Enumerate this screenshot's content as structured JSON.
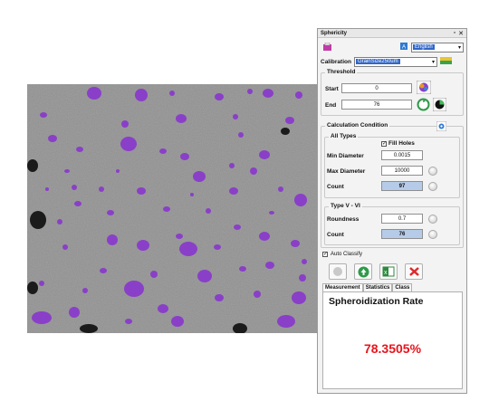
{
  "panel": {
    "title": "Sphericity",
    "language": "English",
    "calibration_label": "Calibration",
    "calibration_value": "GrainSize250um",
    "threshold": {
      "title": "Threshold",
      "start_label": "Start",
      "start_value": "0",
      "end_label": "End",
      "end_value": "76"
    },
    "calc": {
      "title": "Calculation Condition",
      "all_types": {
        "title": "All Types",
        "fill_holes": "Fill Holes",
        "min_diameter_label": "Min Diameter",
        "min_diameter_value": "0.0015",
        "max_diameter_label": "Max Diameter",
        "max_diameter_value": "10000",
        "count_label": "Count",
        "count_value": "97"
      },
      "type_v_vi": {
        "title": "Type V - VI",
        "roundness_label": "Roundness",
        "roundness_value": "0.7",
        "count_label": "Count",
        "count_value": "76"
      }
    },
    "auto_classify": "Auto Classify",
    "tabs": [
      "Measurement",
      "Statistics",
      "Class"
    ],
    "result_title": "Spheroidization Rate",
    "result_value": "78.3505%"
  },
  "colors": {
    "particle": "#8a3fc8",
    "result_red": "#e8141c",
    "count_blue": "#b5cbe8"
  }
}
